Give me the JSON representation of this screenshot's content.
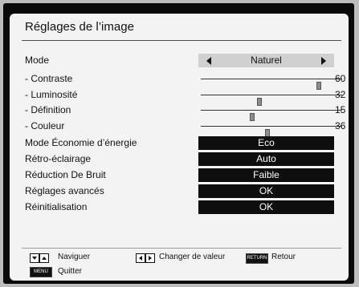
{
  "title": "Réglages de l’image",
  "menu": {
    "mode": {
      "label": "Mode",
      "value": "Naturel"
    },
    "sliders": [
      {
        "label": "- Contraste",
        "value": 60
      },
      {
        "label": "- Luminosité",
        "value": 32
      },
      {
        "label": "- Définition",
        "value": 15
      },
      {
        "label": "- Couleur",
        "value": 36
      }
    ],
    "options": [
      {
        "label": "Mode Économie d’énergie",
        "value": "Eco"
      },
      {
        "label": "Rétro-éclairage",
        "value": "Auto"
      },
      {
        "label": "Réduction De Bruit",
        "value": "Faible"
      },
      {
        "label": "Réglages avancés",
        "value": "OK"
      },
      {
        "label": "Réinitialisation",
        "value": "OK"
      }
    ]
  },
  "footer": {
    "navigate": "Naviguer",
    "change_value": "Changer de valeur",
    "return_key": "RETURN",
    "return_label": "Retour",
    "menu_key": "MENU",
    "quit": "Quitter"
  }
}
